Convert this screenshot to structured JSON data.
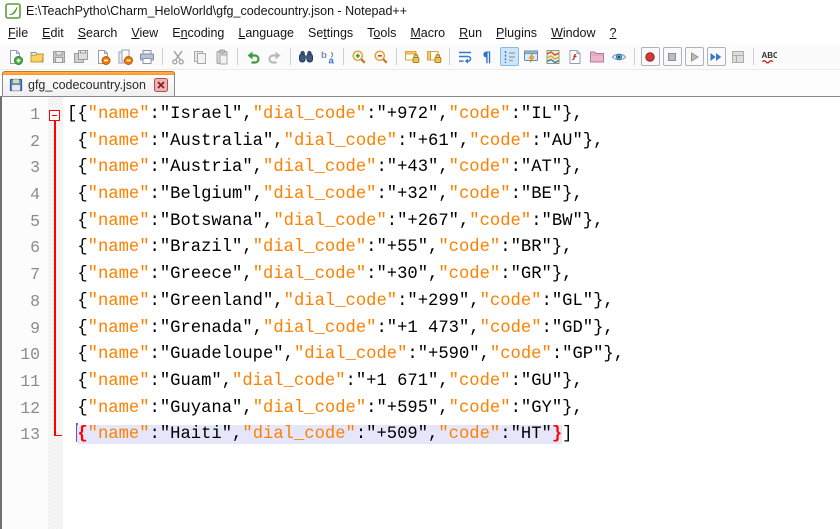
{
  "window": {
    "title": "E:\\TeachPytho\\Charm_HeloWorld\\gfg_codecountry.json - Notepad++"
  },
  "menu": {
    "items": [
      {
        "label": "File",
        "underline_index": 0
      },
      {
        "label": "Edit",
        "underline_index": 0
      },
      {
        "label": "Search",
        "underline_index": 0
      },
      {
        "label": "View",
        "underline_index": 0
      },
      {
        "label": "Encoding",
        "underline_index": 1
      },
      {
        "label": "Language",
        "underline_index": 0
      },
      {
        "label": "Settings",
        "underline_index": 2
      },
      {
        "label": "Tools",
        "underline_index": 1
      },
      {
        "label": "Macro",
        "underline_index": 0
      },
      {
        "label": "Run",
        "underline_index": 0
      },
      {
        "label": "Plugins",
        "underline_index": 0
      },
      {
        "label": "Window",
        "underline_index": 0
      },
      {
        "label": "?",
        "underline_index": 0
      }
    ]
  },
  "toolbar": {
    "icons": [
      {
        "name": "new-file",
        "enabled": true
      },
      {
        "name": "open-file",
        "enabled": true
      },
      {
        "name": "save",
        "enabled": false
      },
      {
        "name": "save-all",
        "enabled": false
      },
      {
        "name": "close",
        "enabled": true
      },
      {
        "name": "close-all",
        "enabled": true
      },
      {
        "name": "print",
        "enabled": true
      },
      {
        "sep": true
      },
      {
        "name": "cut",
        "enabled": false
      },
      {
        "name": "copy",
        "enabled": false
      },
      {
        "name": "paste",
        "enabled": false
      },
      {
        "sep": true
      },
      {
        "name": "undo",
        "enabled": true
      },
      {
        "name": "redo",
        "enabled": false
      },
      {
        "sep": true
      },
      {
        "name": "find",
        "enabled": true
      },
      {
        "name": "replace",
        "enabled": true
      },
      {
        "sep": true
      },
      {
        "name": "zoom-in",
        "enabled": true
      },
      {
        "name": "zoom-out",
        "enabled": true
      },
      {
        "sep": true
      },
      {
        "name": "sync-vertical-scroll",
        "enabled": true
      },
      {
        "name": "sync-horizontal-scroll",
        "enabled": true
      },
      {
        "sep": true
      },
      {
        "name": "word-wrap",
        "enabled": true
      },
      {
        "name": "show-all-characters",
        "enabled": true
      },
      {
        "name": "show-indent-guide",
        "enabled": true,
        "active": true
      },
      {
        "name": "user-defined-dialog",
        "enabled": true
      },
      {
        "name": "document-map",
        "enabled": true
      },
      {
        "name": "function-list",
        "enabled": true
      },
      {
        "name": "folder-as-workspace",
        "enabled": true
      },
      {
        "name": "monitoring",
        "enabled": true
      },
      {
        "sep": true
      },
      {
        "name": "macro-record",
        "enabled": true,
        "boxed": true
      },
      {
        "name": "macro-stop",
        "enabled": false,
        "boxed": true
      },
      {
        "name": "macro-play",
        "enabled": false,
        "boxed": true
      },
      {
        "name": "macro-run-multiple",
        "enabled": true,
        "boxed": true
      },
      {
        "name": "macro-save",
        "enabled": false
      },
      {
        "sep": true
      },
      {
        "name": "spell-check",
        "enabled": true
      }
    ]
  },
  "tabs": [
    {
      "label": "gfg_codecountry.json",
      "active": true,
      "saved": true
    }
  ],
  "editor": {
    "language": "json",
    "current_line": 13,
    "colors": {
      "key": "#ff8000",
      "value": "#000000",
      "brace_match": "#ff0000",
      "selection": "#e6e6fa",
      "fold": "#ff0000",
      "line_number": "#8a8a8a",
      "tab_accent": "#ff9326"
    },
    "entries": [
      {
        "name": "Israel",
        "dial_code": "+972",
        "code": "IL"
      },
      {
        "name": "Australia",
        "dial_code": "+61",
        "code": "AU"
      },
      {
        "name": "Austria",
        "dial_code": "+43",
        "code": "AT"
      },
      {
        "name": "Belgium",
        "dial_code": "+32",
        "code": "BE"
      },
      {
        "name": "Botswana",
        "dial_code": "+267",
        "code": "BW"
      },
      {
        "name": "Brazil",
        "dial_code": "+55",
        "code": "BR"
      },
      {
        "name": "Greece",
        "dial_code": "+30",
        "code": "GR"
      },
      {
        "name": "Greenland",
        "dial_code": "+299",
        "code": "GL"
      },
      {
        "name": "Grenada",
        "dial_code": "+1 473",
        "code": "GD"
      },
      {
        "name": "Guadeloupe",
        "dial_code": "+590",
        "code": "GP"
      },
      {
        "name": "Guam",
        "dial_code": "+1 671",
        "code": "GU"
      },
      {
        "name": "Guyana",
        "dial_code": "+595",
        "code": "GY"
      },
      {
        "name": "Haiti",
        "dial_code": "+509",
        "code": "HT"
      }
    ]
  }
}
